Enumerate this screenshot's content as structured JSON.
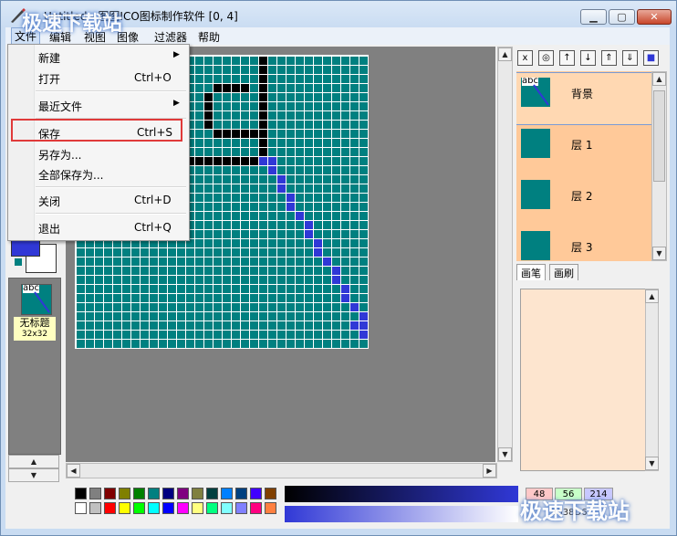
{
  "window": {
    "title": "Untitled - 图图ICO图标制作软件 [0, 4]",
    "minimize_icon": "minimize-icon",
    "maximize_icon": "maximize-icon",
    "close_icon": "close-icon"
  },
  "menubar": {
    "items": [
      {
        "label": "文件"
      },
      {
        "label": "编辑"
      },
      {
        "label": "视图"
      },
      {
        "label": "图像"
      },
      {
        "label": "过滤器"
      },
      {
        "label": "帮助"
      }
    ]
  },
  "file_menu": {
    "items": [
      {
        "label": "新建",
        "shortcut": "",
        "submenu": true
      },
      {
        "label": "打开",
        "shortcut": "Ctrl+O",
        "submenu": false
      },
      {
        "label": "最近文件",
        "shortcut": "",
        "submenu": true
      },
      {
        "label": "保存",
        "shortcut": "Ctrl+S",
        "submenu": false,
        "highlighted": true
      },
      {
        "label": "另存为...",
        "shortcut": "",
        "submenu": false
      },
      {
        "label": "全部保存为...",
        "shortcut": "",
        "submenu": false
      },
      {
        "label": "关闭",
        "shortcut": "Ctrl+D",
        "submenu": false
      },
      {
        "label": "退出",
        "shortcut": "Ctrl+Q",
        "submenu": false
      }
    ],
    "submenu_arrow": "▶"
  },
  "left_panel": {
    "document": {
      "thumb_text": "abc",
      "name": "无标题",
      "size": "32x32"
    },
    "scroll_up": "▲",
    "scroll_down": "▼"
  },
  "layers_toolbar": {
    "icons": [
      "delete-layer-icon",
      "eye-icon",
      "move-up-icon",
      "move-down-icon",
      "merge-up-icon",
      "merge-down-icon",
      "layer-color-icon"
    ],
    "labels": [
      "x",
      "◎",
      "↑",
      "↓",
      "⇑",
      "⇓",
      "■"
    ]
  },
  "layers": [
    {
      "name": "背景",
      "thumb_text": "abc",
      "selected": true
    },
    {
      "name": "层 1",
      "thumb_text": "",
      "selected": false
    },
    {
      "name": "层 2",
      "thumb_text": "",
      "selected": false
    },
    {
      "name": "层 3",
      "thumb_text": "",
      "selected": false
    }
  ],
  "tool_tabs": [
    {
      "label": "画笔"
    },
    {
      "label": "画刷"
    }
  ],
  "color": {
    "r": "48",
    "g": "56",
    "b": "214",
    "hex": "3038D6",
    "foreground": "#3038d6",
    "background": "#ffffff"
  },
  "palette": {
    "row1": [
      "#000000",
      "#808080",
      "#800000",
      "#808000",
      "#008000",
      "#008080",
      "#000080",
      "#800080",
      "#808040",
      "#004040",
      "#0080ff",
      "#004080",
      "#4000ff",
      "#804000"
    ],
    "row2": [
      "#ffffff",
      "#c0c0c0",
      "#ff0000",
      "#ffff00",
      "#00ff00",
      "#00ffff",
      "#0000ff",
      "#ff00ff",
      "#ffff80",
      "#00ff80",
      "#80ffff",
      "#8080ff",
      "#ff0080",
      "#ff8040"
    ]
  },
  "canvas": {
    "grid": "32x32",
    "fill_color": "#008080",
    "black_pixels": [
      [
        20,
        0
      ],
      [
        20,
        1
      ],
      [
        20,
        2
      ],
      [
        20,
        3
      ],
      [
        20,
        4
      ],
      [
        20,
        5
      ],
      [
        20,
        6
      ],
      [
        20,
        7
      ],
      [
        20,
        8
      ],
      [
        20,
        9
      ],
      [
        20,
        10
      ],
      [
        20,
        11
      ],
      [
        15,
        3
      ],
      [
        16,
        3
      ],
      [
        17,
        3
      ],
      [
        18,
        3
      ],
      [
        14,
        4
      ],
      [
        14,
        5
      ],
      [
        14,
        6
      ],
      [
        14,
        7
      ],
      [
        15,
        8
      ],
      [
        16,
        8
      ],
      [
        17,
        8
      ],
      [
        18,
        8
      ],
      [
        19,
        8
      ],
      [
        12,
        11
      ],
      [
        13,
        11
      ],
      [
        14,
        11
      ],
      [
        15,
        11
      ],
      [
        16,
        11
      ],
      [
        17,
        11
      ],
      [
        18,
        11
      ],
      [
        19,
        11
      ]
    ],
    "blue_pixels": [
      [
        20,
        11
      ],
      [
        21,
        11
      ],
      [
        21,
        12
      ],
      [
        22,
        13
      ],
      [
        22,
        14
      ],
      [
        23,
        15
      ],
      [
        23,
        16
      ],
      [
        24,
        17
      ],
      [
        25,
        18
      ],
      [
        25,
        19
      ],
      [
        26,
        20
      ],
      [
        26,
        21
      ],
      [
        27,
        22
      ],
      [
        28,
        23
      ],
      [
        28,
        24
      ],
      [
        29,
        25
      ],
      [
        29,
        26
      ],
      [
        30,
        27
      ],
      [
        31,
        28
      ],
      [
        31,
        29
      ],
      [
        31,
        30
      ],
      [
        30,
        29
      ]
    ]
  },
  "watermark": {
    "text": "极速下载站"
  }
}
